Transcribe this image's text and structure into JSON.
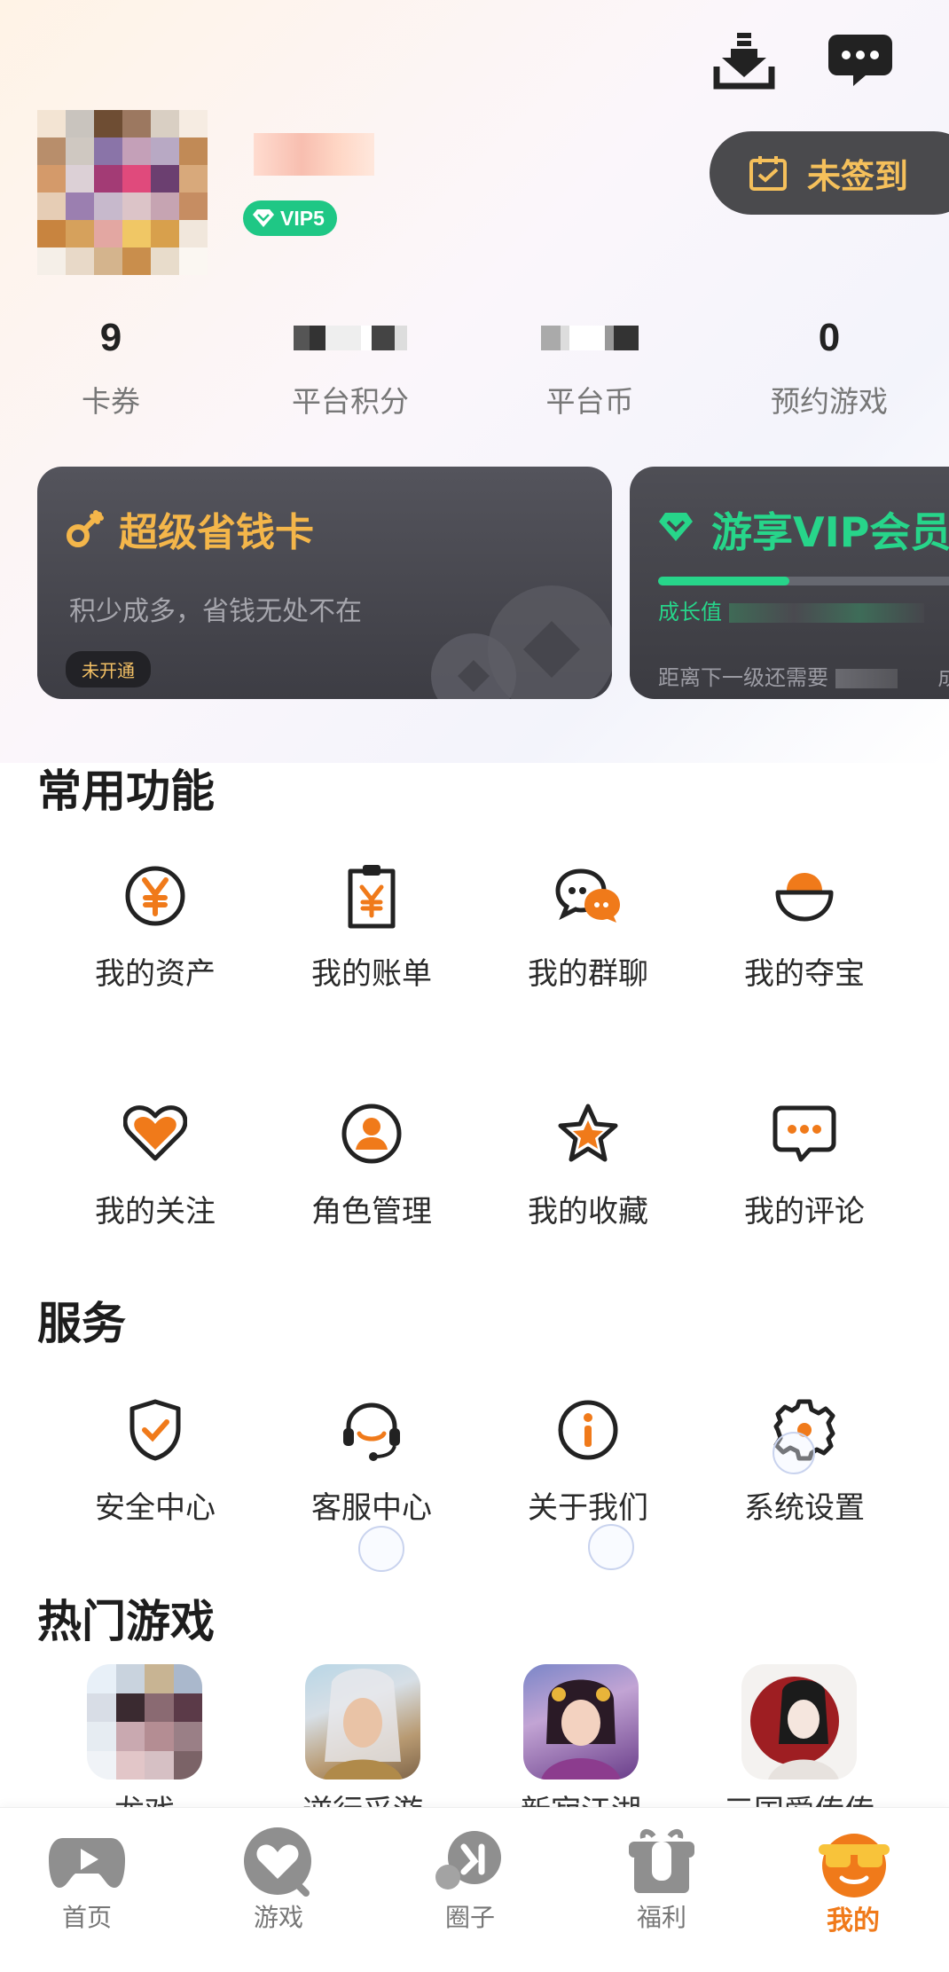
{
  "header": {
    "download_icon": "download-icon",
    "message_icon": "message-icon"
  },
  "profile": {
    "vip_level": "VIP5",
    "signin_label": "未签到"
  },
  "stats": [
    {
      "value": "9",
      "label": "卡券"
    },
    {
      "value": "",
      "label": "平台积分"
    },
    {
      "value": "",
      "label": "平台币"
    },
    {
      "value": "0",
      "label": "预约游戏"
    }
  ],
  "cards": {
    "money_card": {
      "title": "超级省钱卡",
      "subtitle": "积少成多，省钱无处不在",
      "tag": "未开通"
    },
    "vip_card": {
      "title": "游享VIP会员",
      "growth_label": "成长值",
      "next_level": "距离下一级还需要",
      "trailing": "成"
    }
  },
  "common_functions": {
    "title": "常用功能",
    "items": [
      {
        "label": "我的资产",
        "icon": "yuan-coin-icon"
      },
      {
        "label": "我的账单",
        "icon": "bill-icon"
      },
      {
        "label": "我的群聊",
        "icon": "group-chat-icon"
      },
      {
        "label": "我的夺宝",
        "icon": "treasure-bowl-icon"
      },
      {
        "label": "我的关注",
        "icon": "heart-icon"
      },
      {
        "label": "角色管理",
        "icon": "user-icon"
      },
      {
        "label": "我的收藏",
        "icon": "star-icon"
      },
      {
        "label": "我的评论",
        "icon": "comment-icon"
      }
    ]
  },
  "services": {
    "title": "服务",
    "items": [
      {
        "label": "安全中心",
        "icon": "shield-icon"
      },
      {
        "label": "客服中心",
        "icon": "headset-icon"
      },
      {
        "label": "关于我们",
        "icon": "info-icon"
      },
      {
        "label": "系统设置",
        "icon": "gear-icon"
      }
    ]
  },
  "hot_games": {
    "title": "热门游戏",
    "items": [
      {
        "label": "龙戏"
      },
      {
        "label": "逆行采游"
      },
      {
        "label": "新寂江湖"
      },
      {
        "label": "三国爱传传"
      }
    ]
  },
  "tabbar": {
    "items": [
      {
        "label": "首页",
        "icon": "home-gamepad-icon"
      },
      {
        "label": "游戏",
        "icon": "game-heart-icon"
      },
      {
        "label": "圈子",
        "icon": "circle-chat-icon"
      },
      {
        "label": "福利",
        "icon": "gift-icon"
      },
      {
        "label": "我的",
        "icon": "me-face-icon"
      }
    ],
    "active": "我的"
  },
  "colors": {
    "accent": "#f07a1a",
    "vip_green": "#1fc785",
    "gold": "#f4b64a",
    "card_dark": "#45454c"
  }
}
